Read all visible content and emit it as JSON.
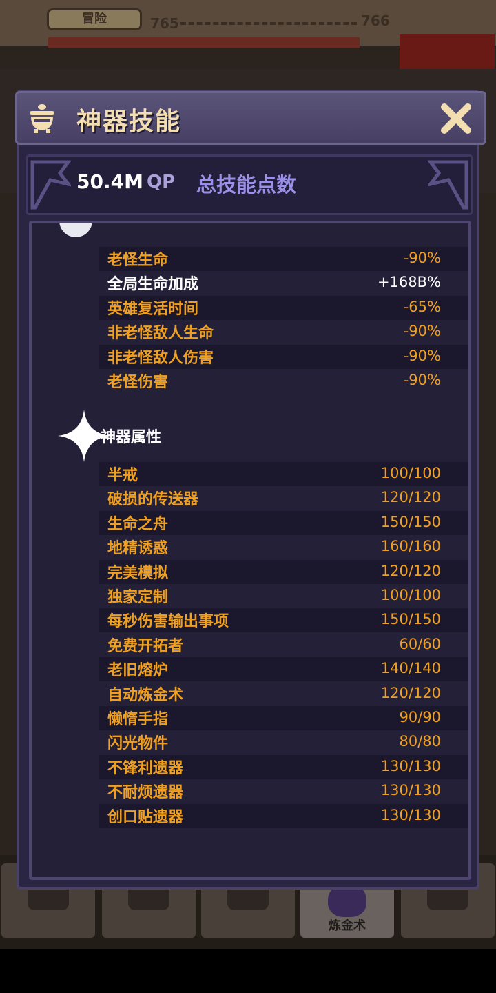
{
  "background": {
    "mode_button": "冒险",
    "level_current": "765",
    "level_next": "766",
    "active_tab_label": "炼金术"
  },
  "dialog": {
    "title": "神器技能",
    "qp_value": "50.4M",
    "qp_unit": "QP",
    "qp_label": "总技能点数",
    "bonus_rows": [
      {
        "label": "老怪生命",
        "value": "-90%"
      },
      {
        "label": "全局生命加成",
        "value": "+168B%"
      },
      {
        "label": "英雄复活时间",
        "value": "-65%"
      },
      {
        "label": "非老怪敌人生命",
        "value": "-90%"
      },
      {
        "label": "非老怪敌人伤害",
        "value": "-90%"
      },
      {
        "label": "老怪伤害",
        "value": "-90%"
      }
    ],
    "artifact_section_title": "神器属性",
    "artifact_rows": [
      {
        "label": "半戒",
        "value": "100/100"
      },
      {
        "label": "破损的传送器",
        "value": "120/120"
      },
      {
        "label": "生命之舟",
        "value": "150/150"
      },
      {
        "label": "地精诱惑",
        "value": "160/160"
      },
      {
        "label": "完美模拟",
        "value": "120/120"
      },
      {
        "label": "独家定制",
        "value": "100/100"
      },
      {
        "label": "每秒伤害输出事项",
        "value": "150/150"
      },
      {
        "label": "免费开拓者",
        "value": "60/60"
      },
      {
        "label": "老旧熔炉",
        "value": "140/140"
      },
      {
        "label": "自动炼金术",
        "value": "120/120"
      },
      {
        "label": "懒惰手指",
        "value": "90/90"
      },
      {
        "label": "闪光物件",
        "value": "80/80"
      },
      {
        "label": "不锋利遗器",
        "value": "130/130"
      },
      {
        "label": "不耐烦遗器",
        "value": "130/130"
      },
      {
        "label": "创口贴遗器",
        "value": "130/130"
      }
    ]
  },
  "icons": {
    "header": "cauldron-icon",
    "close": "close-icon",
    "section": "sparkle-star-icon"
  },
  "colors": {
    "accent_orange": "#f0a020",
    "qp_label": "#9a90e6",
    "title": "#f2deb0"
  }
}
